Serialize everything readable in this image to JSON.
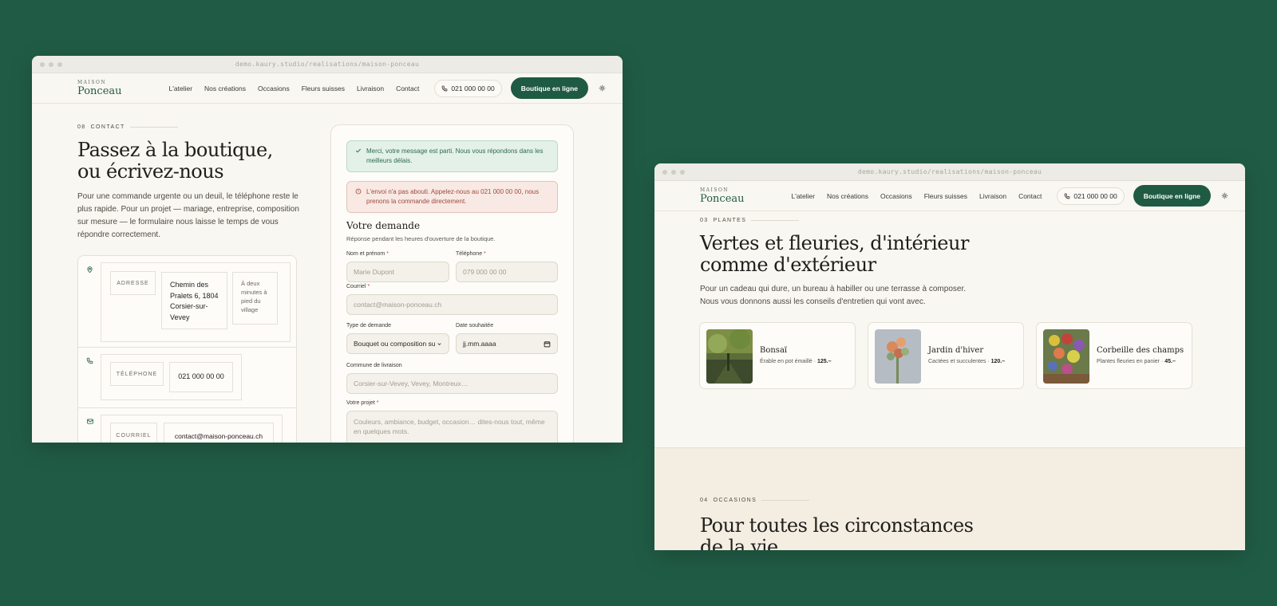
{
  "left": {
    "url": "demo.kaury.studio/realisations/maison-ponceau",
    "nav": {
      "logo_top": "MAISON",
      "logo_name": "Ponceau",
      "items": [
        "L'atelier",
        "Nos créations",
        "Occasions",
        "Fleurs suisses",
        "Livraison",
        "Contact"
      ],
      "phone": "021 000 00 00",
      "shop": "Boutique en ligne"
    },
    "section": {
      "num": "08",
      "label": "CONTACT",
      "title": "Passez à la boutique, ou écrivez-nous",
      "lead": "Pour une commande urgente ou un deuil, le téléphone reste le plus rapide. Pour un projet — mariage, entreprise, composition sur mesure — le formulaire nous laisse le temps de vous répondre correctement."
    },
    "info": {
      "address_label": "ADRESSE",
      "address_value": "Chemin des Pralets 6, 1804 Corsier-sur-Vevey",
      "address_note": "À deux minutes à pied du village",
      "phone_label": "TÉLÉPHONE",
      "phone_value": "021 000 00 00",
      "email_label": "COURRIEL",
      "email_value": "contact@maison-ponceau.ch"
    },
    "form": {
      "success": "Merci, votre message est parti. Nous vous répondons dans les meilleurs délais.",
      "error": "L'envoi n'a pas abouti. Appelez-nous au 021 000 00 00, nous prenons la commande directement.",
      "title": "Votre demande",
      "subtitle": "Réponse pendant les heures d'ouverture de la boutique.",
      "name_label": "Nom et prénom",
      "name_placeholder": "Marie Dupont",
      "tel_label": "Téléphone",
      "tel_placeholder": "079 000 00 00",
      "email_label": "Courriel",
      "email_placeholder": "contact@maison-ponceau.ch",
      "type_label": "Type de demande",
      "type_value": "Bouquet ou composition su",
      "date_label": "Date souhaitée",
      "date_value": "jj.mm.aaaa",
      "commune_label": "Commune de livraison",
      "commune_placeholder": "Corsier-sur-Vevey, Vevey, Montreux…",
      "project_label": "Votre projet",
      "project_placeholder": "Couleurs, ambiance, budget, occasion… dites-nous tout, même en quelques mots.",
      "required_mark": "*"
    }
  },
  "right": {
    "url": "demo.kaury.studio/realisations/maison-ponceau",
    "nav": {
      "logo_top": "MAISON",
      "logo_name": "Ponceau",
      "items": [
        "L'atelier",
        "Nos créations",
        "Occasions",
        "Fleurs suisses",
        "Livraison",
        "Contact"
      ],
      "phone": "021 000 00 00",
      "shop": "Boutique en ligne"
    },
    "section": {
      "num": "03",
      "label": "PLANTES",
      "title": "Vertes et fleuries, d'intérieur comme d'extérieur",
      "lead": "Pour un cadeau qui dure, un bureau à habiller ou une terrasse à composer. Nous vous donnons aussi les conseils d'entretien qui vont avec."
    },
    "cards": [
      {
        "title": "Bonsaï",
        "desc": "Érable en pot émaillé ·",
        "price": "125.–"
      },
      {
        "title": "Jardin d'hiver",
        "desc": "Cactées et succulentes ·",
        "price": "120.–"
      },
      {
        "title": "Corbeille des champs",
        "desc": "Plantes fleuries en panier ·",
        "price": "45.–"
      }
    ],
    "next": {
      "num": "04",
      "label": "OCCASIONS",
      "title": "Pour toutes les circonstances de la vie"
    }
  }
}
